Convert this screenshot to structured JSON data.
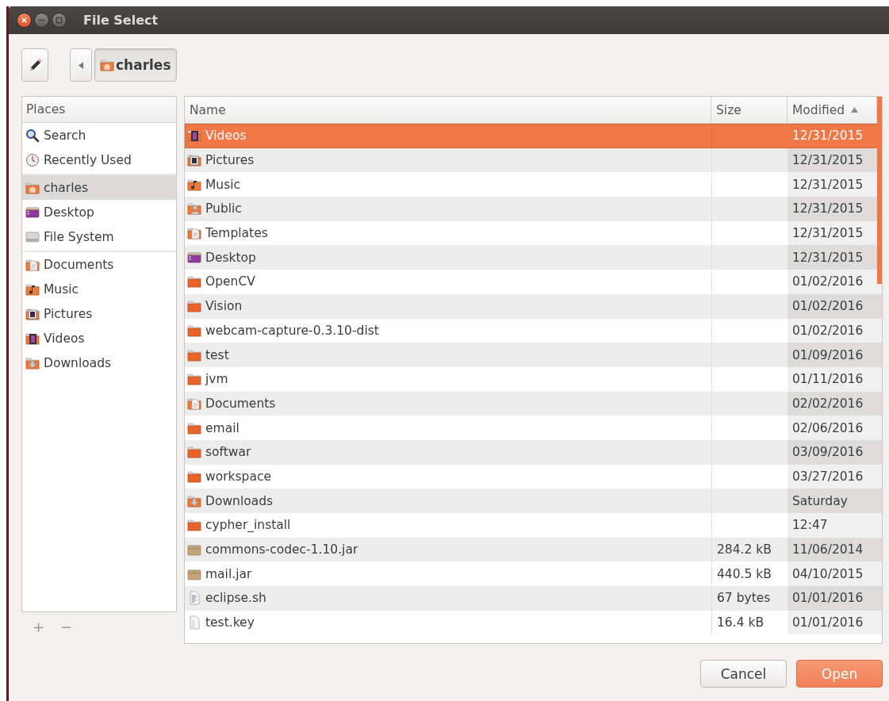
{
  "window": {
    "title": "File Select"
  },
  "toolbar": {
    "path_buttons": [
      {
        "label": "charles",
        "kind": "home",
        "selected": true
      }
    ]
  },
  "sidebar": {
    "title": "Places",
    "groups": [
      {
        "items": [
          {
            "label": "Search",
            "kind": "search",
            "selected": false
          },
          {
            "label": "Recently Used",
            "kind": "recent",
            "selected": false
          }
        ]
      },
      {
        "items": [
          {
            "label": "charles",
            "kind": "home",
            "selected": true
          },
          {
            "label": "Desktop",
            "kind": "desktop",
            "selected": false
          },
          {
            "label": "File System",
            "kind": "drive",
            "selected": false
          }
        ]
      },
      {
        "items": [
          {
            "label": "Documents",
            "kind": "documents",
            "selected": false
          },
          {
            "label": "Music",
            "kind": "music",
            "selected": false
          },
          {
            "label": "Pictures",
            "kind": "pictures",
            "selected": false
          },
          {
            "label": "Videos",
            "kind": "videos",
            "selected": false
          },
          {
            "label": "Downloads",
            "kind": "downloads",
            "selected": false
          }
        ]
      }
    ],
    "actions": [
      {
        "label": "+",
        "disabled": true
      },
      {
        "label": "−",
        "disabled": true
      }
    ]
  },
  "file_list": {
    "columns": [
      {
        "label": "Name",
        "sorted": false
      },
      {
        "label": "Size",
        "sorted": false
      },
      {
        "label": "Modified",
        "sorted": true
      }
    ],
    "rows": [
      {
        "name": "Videos",
        "kind": "videos",
        "size": "",
        "modified": "12/31/2015",
        "selected": true
      },
      {
        "name": "Pictures",
        "kind": "pictures",
        "size": "",
        "modified": "12/31/2015",
        "selected": false
      },
      {
        "name": "Music",
        "kind": "music",
        "size": "",
        "modified": "12/31/2015",
        "selected": false
      },
      {
        "name": "Public",
        "kind": "public",
        "size": "",
        "modified": "12/31/2015",
        "selected": false
      },
      {
        "name": "Templates",
        "kind": "templates",
        "size": "",
        "modified": "12/31/2015",
        "selected": false
      },
      {
        "name": "Desktop",
        "kind": "desktop",
        "size": "",
        "modified": "12/31/2015",
        "selected": false
      },
      {
        "name": "OpenCV",
        "kind": "folder",
        "size": "",
        "modified": "01/02/2016",
        "selected": false
      },
      {
        "name": "Vision",
        "kind": "folder",
        "size": "",
        "modified": "01/02/2016",
        "selected": false
      },
      {
        "name": "webcam-capture-0.3.10-dist",
        "kind": "folder",
        "size": "",
        "modified": "01/02/2016",
        "selected": false
      },
      {
        "name": "test",
        "kind": "folder",
        "size": "",
        "modified": "01/09/2016",
        "selected": false
      },
      {
        "name": "jvm",
        "kind": "folder",
        "size": "",
        "modified": "01/11/2016",
        "selected": false
      },
      {
        "name": "Documents",
        "kind": "documents",
        "size": "",
        "modified": "02/02/2016",
        "selected": false
      },
      {
        "name": "email",
        "kind": "folder",
        "size": "",
        "modified": "02/06/2016",
        "selected": false
      },
      {
        "name": "softwar",
        "kind": "folder",
        "size": "",
        "modified": "03/09/2016",
        "selected": false
      },
      {
        "name": "workspace",
        "kind": "folder",
        "size": "",
        "modified": "03/27/2016",
        "selected": false
      },
      {
        "name": "Downloads",
        "kind": "downloads",
        "size": "",
        "modified": "Saturday",
        "selected": false
      },
      {
        "name": "cypher_install",
        "kind": "folder",
        "size": "",
        "modified": "12:47",
        "selected": false
      },
      {
        "name": "commons-codec-1.10.jar",
        "kind": "jar",
        "size": "284.2 kB",
        "modified": "11/06/2014",
        "selected": false
      },
      {
        "name": "mail.jar",
        "kind": "jar",
        "size": "440.5 kB",
        "modified": "04/10/2015",
        "selected": false
      },
      {
        "name": "eclipse.sh",
        "kind": "script",
        "size": "67 bytes",
        "modified": "01/01/2016",
        "selected": false
      },
      {
        "name": "test.key",
        "kind": "text",
        "size": "16.4 kB",
        "modified": "01/01/2016",
        "selected": false
      }
    ]
  },
  "buttons": [
    {
      "label": "Cancel",
      "kind": "default"
    },
    {
      "label": "Open",
      "kind": "suggested"
    }
  ]
}
